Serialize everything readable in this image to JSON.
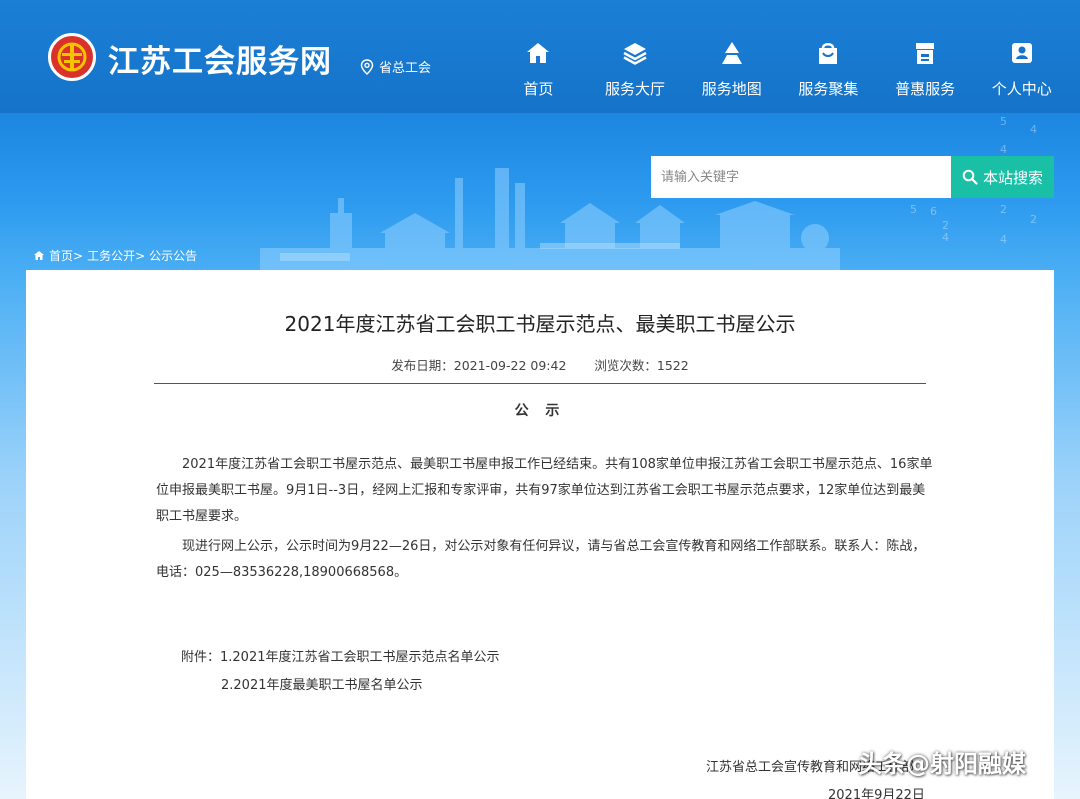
{
  "header": {
    "site_title": "江苏工会服务网",
    "province_label": "省总工会",
    "nav": [
      {
        "label": "首页",
        "icon": "home-icon"
      },
      {
        "label": "服务大厅",
        "icon": "layers-icon"
      },
      {
        "label": "服务地图",
        "icon": "map-icon"
      },
      {
        "label": "服务聚集",
        "icon": "bag-icon"
      },
      {
        "label": "普惠服务",
        "icon": "shop-icon"
      },
      {
        "label": "个人中心",
        "icon": "user-icon"
      }
    ]
  },
  "search": {
    "placeholder": "请输入关键字",
    "button_label": "本站搜索"
  },
  "breadcrumb": [
    "首页>",
    "工务公开>",
    "公示公告"
  ],
  "article": {
    "title": "2021年度江苏省工会职工书屋示范点、最美职工书屋公示",
    "publish_date": "发布日期：2021-09-22 09:42",
    "views": "浏览次数：1522",
    "notice_heading": "公 示",
    "paragraph1": "2021年度江苏省工会职工书屋示范点、最美职工书屋申报工作已经结束。共有108家单位申报江苏省工会职工书屋示范点、16家单位申报最美职工书屋。9月1日--3日，经网上汇报和专家评审，共有97家单位达到江苏省工会职工书屋示范点要求，12家单位达到最美职工书屋要求。",
    "paragraph2": "现进行网上公示，公示时间为9月22—26日，对公示对象有任何异议，请与省总工会宣传教育和网络工作部联系。联系人：陈战，电话：025—83536228,18900668568。",
    "attachment1": "附件：1.2021年度江苏省工会职工书屋示范点名单公示",
    "attachment2": "2.2021年度最美职工书屋名单公示",
    "signature": "江苏省总工会宣传教育和网络工作部",
    "date": "2021年9月22日"
  },
  "watermark": "头条@射阳融媒",
  "colors": {
    "header_blue": "#1573c9",
    "search_button": "#19c0a6",
    "logo_red": "#d9322b"
  }
}
